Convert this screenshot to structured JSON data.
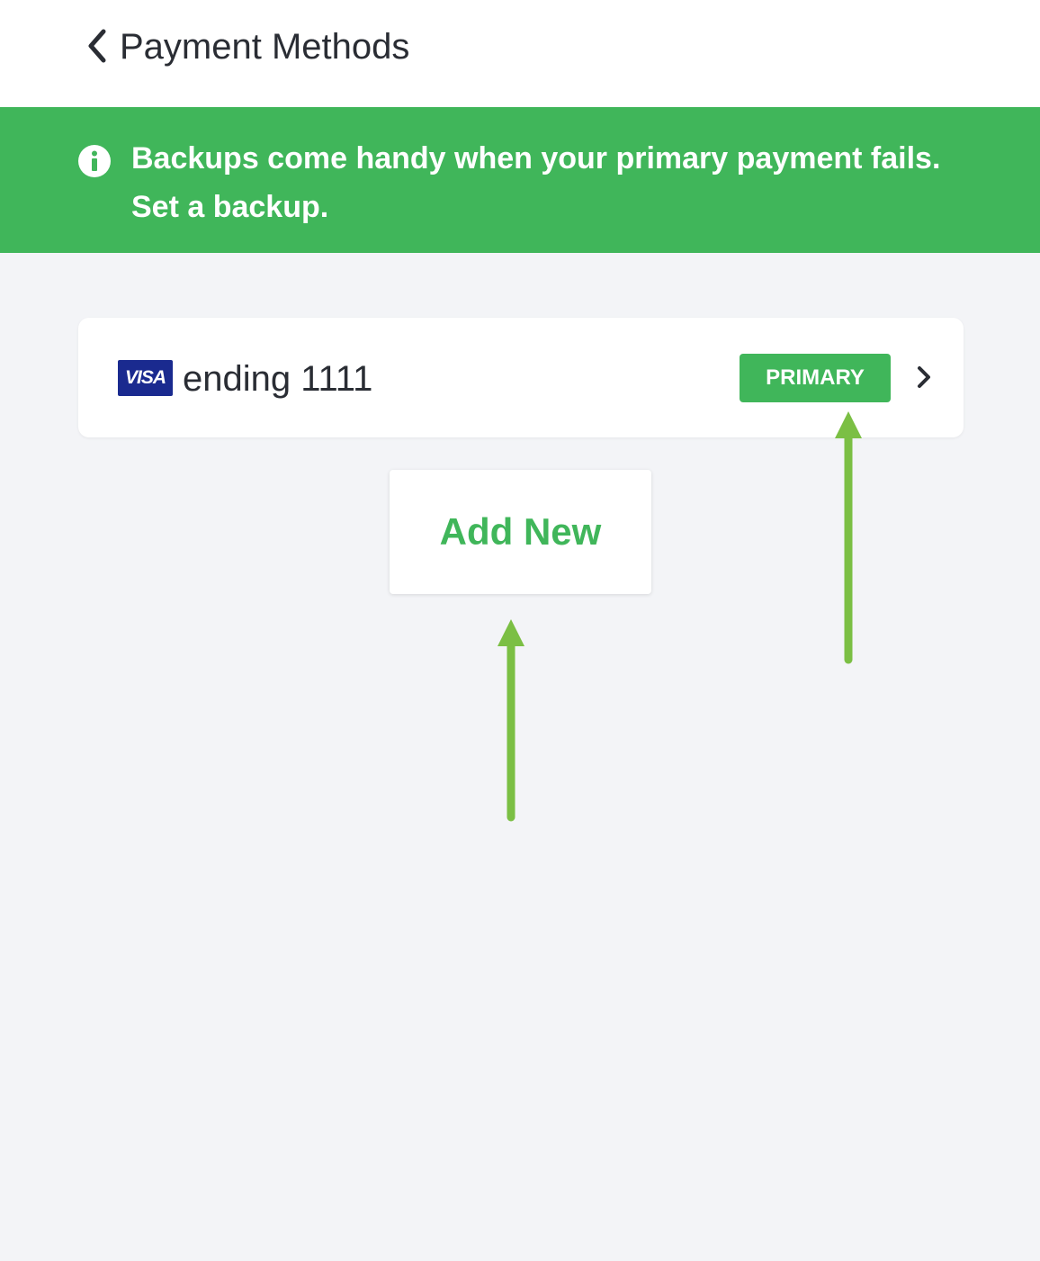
{
  "header": {
    "title": "Payment Methods",
    "back_icon": "chevron-left-icon"
  },
  "banner": {
    "icon": "info-icon",
    "line1": "Backups come handy when your primary payment fails.",
    "line2": "Set a backup.",
    "color": "#40b65a"
  },
  "payment_methods": [
    {
      "brand": "VISA",
      "label": "ending 1111",
      "badge": "PRIMARY",
      "chevron_icon": "chevron-right-icon"
    }
  ],
  "add_new": {
    "label": "Add New"
  },
  "colors": {
    "accent": "#40b65a",
    "background": "#f3f4f7",
    "text": "#2a2d34",
    "visa_blue": "#1a2a8f",
    "annotation_arrow": "#7bbf44"
  }
}
